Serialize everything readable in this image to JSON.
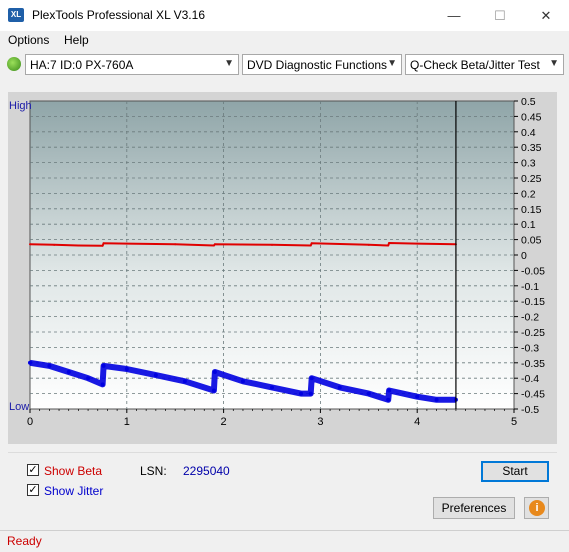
{
  "window": {
    "icon_text": "XL",
    "title": "PlexTools Professional XL V3.16",
    "minimize": "—",
    "maximize": "☐",
    "close": "✕"
  },
  "menu": {
    "items": [
      {
        "label": "Options"
      },
      {
        "label": "Help"
      }
    ]
  },
  "toolbar": {
    "drive": "HA:7 ID:0  PX-760A",
    "function": "DVD Diagnostic Functions",
    "test": "Q-Check Beta/Jitter Test"
  },
  "chart_data": {
    "type": "line",
    "x_ticks": [
      "0",
      "1",
      "2",
      "3",
      "4",
      "5"
    ],
    "xlim": [
      0,
      5
    ],
    "y_ticks": [
      "0.5",
      "0.45",
      "0.4",
      "0.35",
      "0.3",
      "0.25",
      "0.2",
      "0.15",
      "0.1",
      "0.05",
      "0",
      "-0.05",
      "-0.1",
      "-0.15",
      "-0.2",
      "-0.25",
      "-0.3",
      "-0.35",
      "-0.4",
      "-0.45",
      "-0.5"
    ],
    "ylim": [
      -0.5,
      0.5
    ],
    "left_label_top": "High",
    "left_label_bottom": "Low",
    "grid": true,
    "marker_x": 4.4,
    "series": [
      {
        "color": "#e00000",
        "x": [
          0,
          0.25,
          0.5,
          0.75,
          0.76,
          1.0,
          1.5,
          1.9,
          1.91,
          2.5,
          2.9,
          2.91,
          3.5,
          3.7,
          3.71,
          4.0,
          4.4
        ],
        "y": [
          0.035,
          0.033,
          0.031,
          0.03,
          0.038,
          0.037,
          0.035,
          0.031,
          0.035,
          0.033,
          0.031,
          0.038,
          0.033,
          0.031,
          0.039,
          0.037,
          0.035
        ]
      },
      {
        "color": "#0000e0",
        "x": [
          0,
          0.2,
          0.4,
          0.6,
          0.75,
          0.76,
          1.0,
          1.3,
          1.6,
          1.9,
          1.91,
          2.2,
          2.5,
          2.8,
          2.9,
          2.91,
          3.2,
          3.5,
          3.7,
          3.71,
          4.0,
          4.2,
          4.4
        ],
        "y": [
          -0.35,
          -0.36,
          -0.38,
          -0.4,
          -0.42,
          -0.36,
          -0.37,
          -0.39,
          -0.41,
          -0.44,
          -0.38,
          -0.41,
          -0.43,
          -0.45,
          -0.45,
          -0.4,
          -0.43,
          -0.45,
          -0.47,
          -0.44,
          -0.46,
          -0.47,
          -0.47
        ]
      }
    ]
  },
  "options": {
    "show_beta_label": "Show Beta",
    "show_jitter_label": "Show Jitter",
    "show_beta_checked": true,
    "show_jitter_checked": true,
    "lsn_label": "LSN:",
    "lsn_value": "2295040",
    "start_label": "Start",
    "preferences_label": "Preferences",
    "info_icon": "i"
  },
  "status": {
    "text": "Ready"
  }
}
